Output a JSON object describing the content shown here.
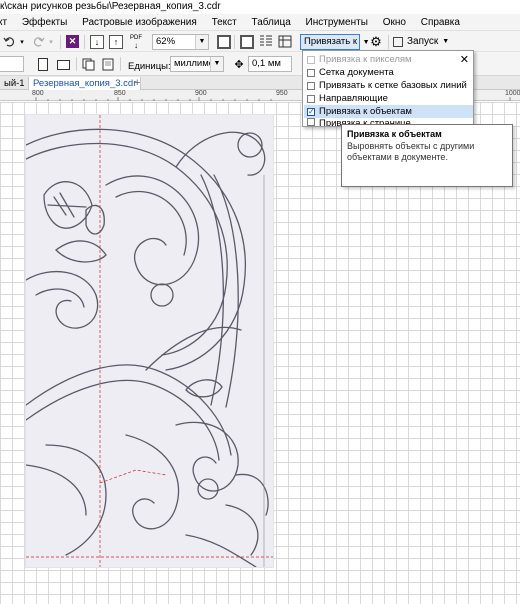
{
  "window": {
    "title": "к\\скан рисунков резьбы\\Резервная_копия_3.cdr"
  },
  "menu": {
    "items": [
      "кт",
      "Эффекты",
      "Растровые изображения",
      "Текст",
      "Таблица",
      "Инструменты",
      "Окно",
      "Справка"
    ]
  },
  "toolbar1": {
    "pdf_label": "PDF",
    "zoom_value": "62%",
    "snap_button_label": "Привязать к",
    "launch_label": "Запуск"
  },
  "toolbar2": {
    "units_label": "Единицы:",
    "units_value": "миллимет...",
    "nudge_value": "0,1 мм"
  },
  "tabs": {
    "items": [
      "ый-1",
      "Резервная_копия_3.cdr"
    ],
    "add": "+"
  },
  "ruler": {
    "ticks": [
      "800",
      "850",
      "900",
      "950",
      "1000"
    ]
  },
  "snap_menu": {
    "items": [
      {
        "label": "Привязка к пикселям",
        "checked": false,
        "disabled": true
      },
      {
        "label": "Сетка документа",
        "checked": false,
        "disabled": false
      },
      {
        "label": "Привязать к сетке базовых линий",
        "checked": false,
        "disabled": false
      },
      {
        "label": "Направляющие",
        "checked": false,
        "disabled": false
      },
      {
        "label": "Привязка к объектам",
        "checked": true,
        "disabled": false
      },
      {
        "label": "Привязка к странице",
        "checked": false,
        "disabled": false
      }
    ]
  },
  "tooltip": {
    "title": "Привязка к объектам",
    "description": "Выровнять объекты с другими объектами в документе."
  },
  "colors": {
    "accent": "#1b55a6",
    "grid": "#d9d9d9",
    "guide": "#cc2222"
  }
}
